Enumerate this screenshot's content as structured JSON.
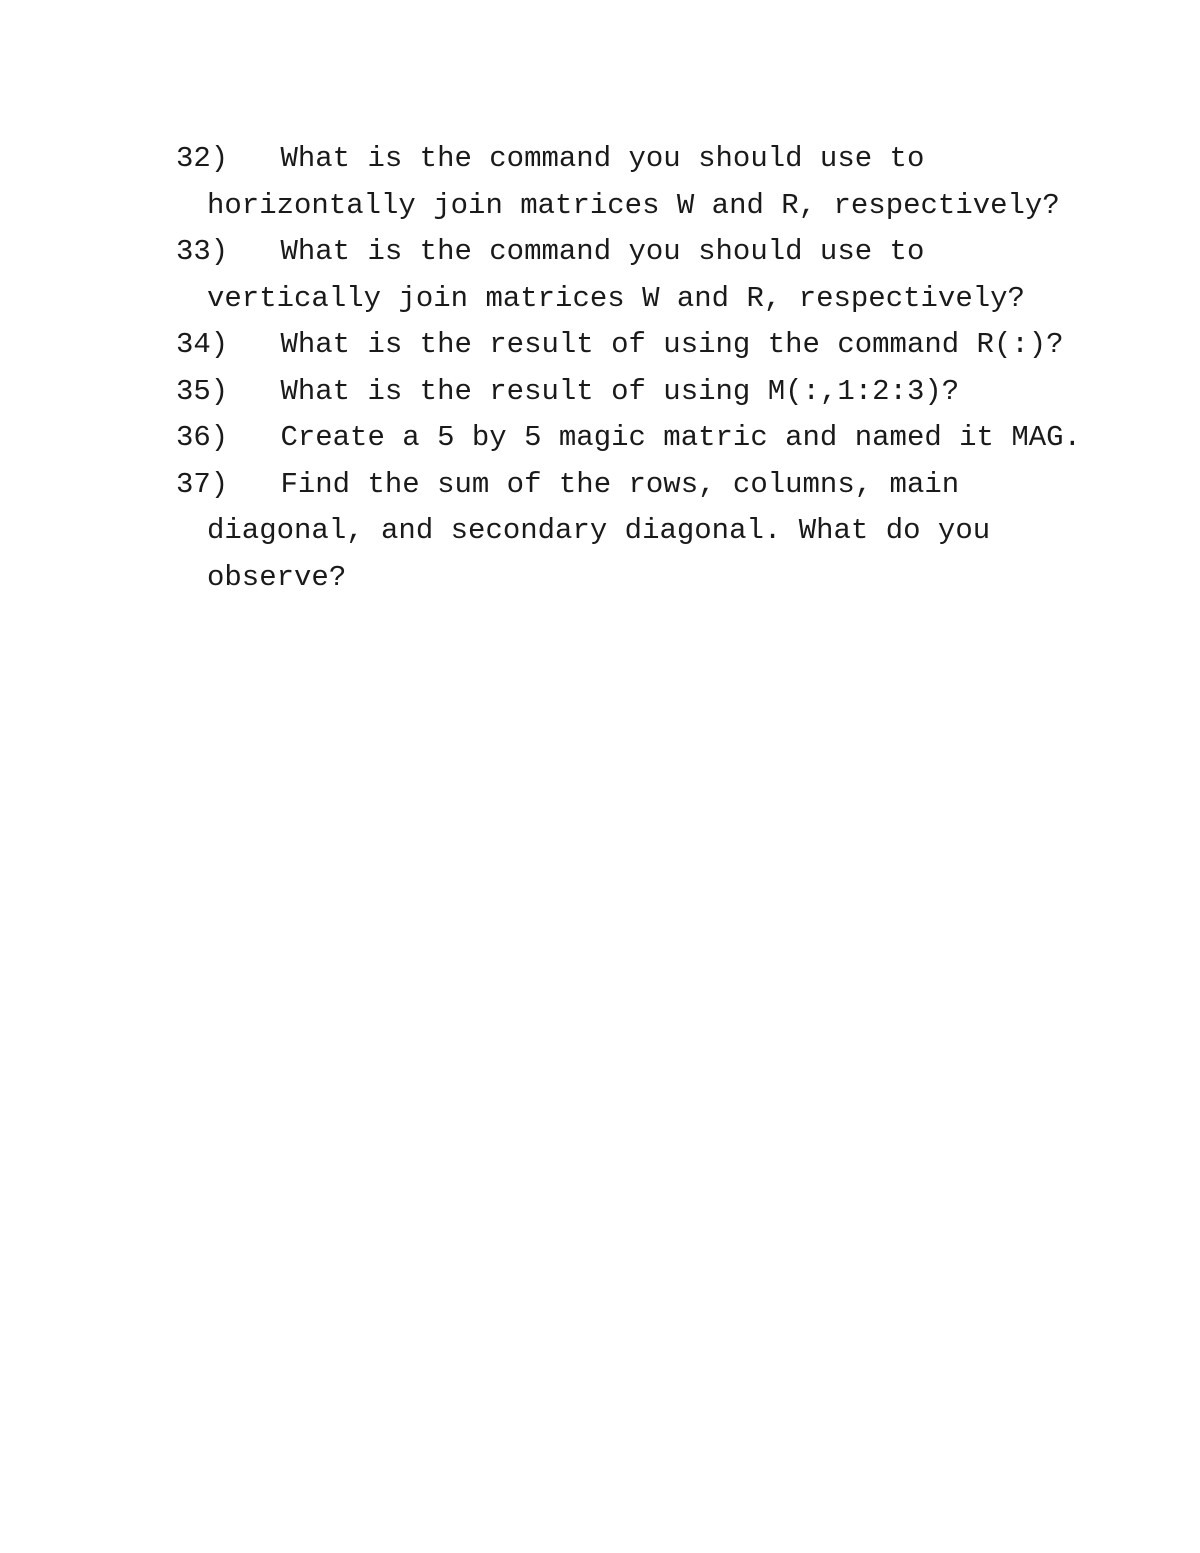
{
  "document": {
    "type": "worksheet-question-list",
    "page_background": "#ffffff",
    "text_color": "#1a1a1a",
    "questions": [
      {
        "number": "32)",
        "gap": "   ",
        "lines": [
          "What is the command you should use to",
          "horizontally join matrices W and R, respectively?"
        ]
      },
      {
        "number": "33)",
        "gap": "   ",
        "lines": [
          "What is the command you should use to",
          "vertically join matrices W and R, respectively?"
        ]
      },
      {
        "number": "34)",
        "gap": "   ",
        "lines": [
          "What is the result of using the command R(:)?"
        ]
      },
      {
        "number": "35)",
        "gap": "   ",
        "lines": [
          "What is the result of using M(:,1:2:3)?"
        ]
      },
      {
        "number": "36)",
        "gap": "   ",
        "lines": [
          "Create a 5 by 5 magic matric and named it MAG."
        ]
      },
      {
        "number": "37)",
        "gap": "   ",
        "lines": [
          "Find the sum of the rows, columns, main",
          "diagonal, and secondary diagonal. What do you",
          "observe?"
        ]
      }
    ]
  }
}
